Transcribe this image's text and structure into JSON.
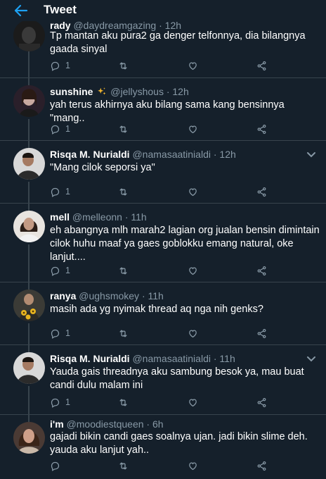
{
  "header": {
    "title": "Tweet",
    "back_icon": "back-arrow-icon"
  },
  "colors": {
    "background": "#15202b",
    "accent": "#1da1f2",
    "muted": "#8899a6",
    "divider": "#38444d"
  },
  "tweets": [
    {
      "name": "rady",
      "handle": "@daydreamgazing",
      "dot": "·",
      "time": "12h",
      "text": "Tp mantan aku pura2 ga denger telfonnya, dia bilangnya gaada sinyal",
      "replies": "1"
    },
    {
      "name": "sunshine",
      "badge": "sparkles",
      "handle": "@jellyshous",
      "dot": "·",
      "time": "12h",
      "text": "yah terus akhirnya aku bilang sama kang bensinnya \"mang..",
      "replies": "1"
    },
    {
      "name": "Risqa M. Nurialdi",
      "handle": "@namasaatinialdi",
      "dot": "·",
      "time": "12h",
      "text": "\"Mang cilok seporsi ya\"",
      "replies": "1"
    },
    {
      "name": "mell",
      "handle": "@melleonn",
      "dot": "·",
      "time": "11h",
      "text": "eh abangnya mlh marah2 lagian org jualan bensin dimintain cilok huhu maaf ya gaes goblokku emang natural, oke lanjut....",
      "replies": "1"
    },
    {
      "name": "ranya",
      "handle": "@ughsmokey",
      "dot": "·",
      "time": "11h",
      "text": "masih ada yg nyimak thread aq nga nih genks?",
      "replies": "1"
    },
    {
      "name": "Risqa M. Nurialdi",
      "handle": "@namasaatinialdi",
      "dot": "·",
      "time": "11h",
      "text": "Yauda gais threadnya aku sambung besok ya, mau buat candi dulu malam ini",
      "replies": "1"
    },
    {
      "name": "i'm",
      "handle": "@moodiestqueen",
      "dot": "·",
      "time": "6h",
      "text": "gajadi bikin candi gaes soalnya ujan. jadi bikin slime deh. yauda aku lanjut yah..",
      "replies": ""
    }
  ]
}
